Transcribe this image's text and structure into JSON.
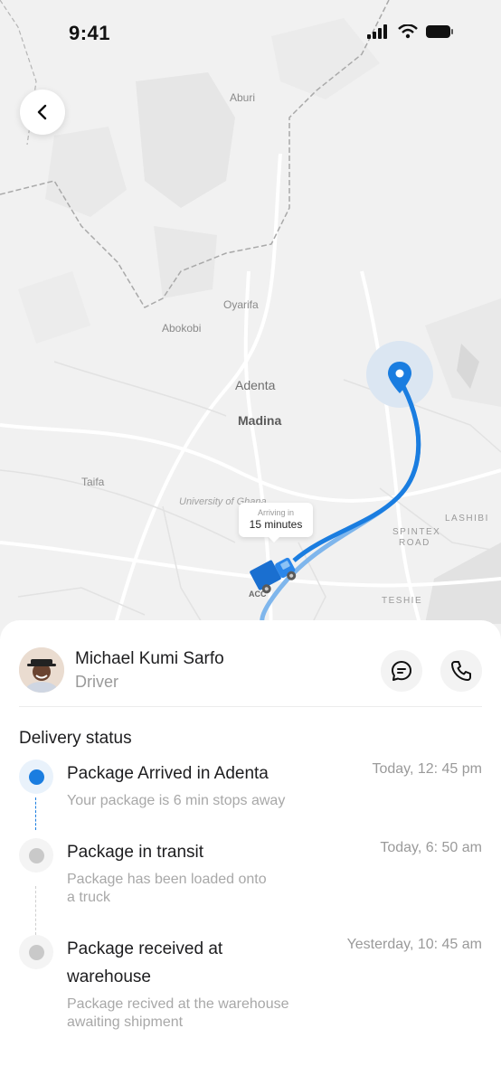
{
  "status_bar": {
    "time": "9:41"
  },
  "map": {
    "labels": {
      "aburi": "Aburi",
      "oyarifa": "Oyarifa",
      "abokobi": "Abokobi",
      "adenta": "Adenta",
      "madina": "Madina",
      "taifa": "Taifa",
      "university": "University of Ghana",
      "lashibi": "LASHIBI",
      "spintex1": "SPINTEX",
      "spintex2": "ROAD",
      "teshie": "TESHIE",
      "acc": "ACC"
    },
    "eta": {
      "caption": "Arriving in",
      "value": "15 minutes"
    },
    "route_color": "#1a7de0"
  },
  "driver": {
    "name": "Michael Kumi Sarfo",
    "role": "Driver"
  },
  "delivery": {
    "title": "Delivery status",
    "steps": [
      {
        "title": "Package Arrived in Adenta",
        "desc": "Your package is 6 min stops away",
        "time": "Today, 12: 45 pm"
      },
      {
        "title": "Package in transit",
        "desc_line1": "Package has been loaded onto",
        "desc_line2": "a truck",
        "time": "Today, 6: 50 am"
      },
      {
        "title_line1": "Package received at",
        "title_line2": "warehouse",
        "desc_line1": "Package recived at the warehouse",
        "desc_line2": "awaiting shipment",
        "time": "Yesterday, 10: 45 am"
      }
    ]
  },
  "icons": [
    "back-icon",
    "chat-icon",
    "phone-icon",
    "location-pin-icon",
    "truck-icon",
    "signal-icon",
    "wifi-icon",
    "battery-icon"
  ]
}
